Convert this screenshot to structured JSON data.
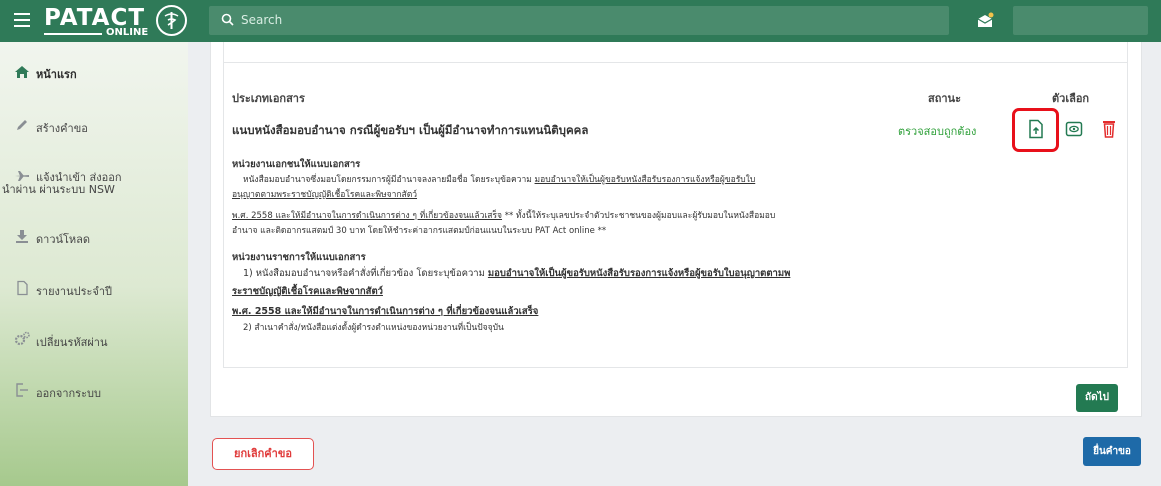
{
  "header": {
    "brand_name": "PATACT",
    "brand_sub": "ONLINE",
    "search_placeholder": "Search"
  },
  "sidebar": {
    "items": [
      {
        "label": "หน้าแรก",
        "icon": "home-icon"
      },
      {
        "label": "สร้างคำขอ",
        "icon": "pencil-icon"
      },
      {
        "label_line1": "แจ้งนำเข้า ส่งออก",
        "label_line2": "นำผ่าน ผ่านระบบ NSW",
        "icon": "plane-icon"
      },
      {
        "label": "ดาวน์โหลด",
        "icon": "download-icon"
      },
      {
        "label": "รายงานประจำปี",
        "icon": "document-icon"
      },
      {
        "label": "เปลี่ยนรหัสผ่าน",
        "icon": "gears-icon"
      },
      {
        "label": "ออกจากระบบ",
        "icon": "logout-icon"
      }
    ]
  },
  "table": {
    "headers": {
      "doc_type": "ประเภทเอกสาร",
      "status": "สถานะ",
      "actions": "ตัวเลือก"
    },
    "row": {
      "title": "แนบหนังสือมอบอำนาจ กรณีผู้ขอรับฯ เป็นผู้มีอำนาจทำการแทนนิติบุคคล",
      "status": "ตรวจสอบถูกต้อง"
    }
  },
  "details": {
    "private": {
      "heading": "หน่วยงานเอกชนให้แนบเอกสาร",
      "l1a": "หนังสือมอบอำนาจซึ่งมอบโดยกรรมการผู้มีอำนาจลงลายมือชื่อ โดยระบุข้อความ ",
      "l1b": "มอบอำนาจให้เป็นผู้ขอรับหนังสือรับรองการแจ้งหรือผู้ขอรับใบ",
      "l2": "อนุญาตตามพระราชบัญญัติเชื้อโรคและพิษจากสัตว์",
      "l3a": "พ.ศ. 2558 และให้มีอำนาจในการดำเนินการต่าง ๆ ที่เกี่ยวข้องจนแล้วเสร็จ",
      "l3b": " ** ทั้งนี้ให้ระบุเลขประจำตัวประชาชนของผู้มอบและผู้รับมอบในหนังสือมอบ",
      "l4": "อำนาจ และติดอากรแสตมป์ 30 บาท โดยให้ชำระค่าอากรแสตมป์ก่อนแนบในระบบ PAT Act online **"
    },
    "government": {
      "heading": "หน่วยงานราชการให้แนบเอกสาร",
      "l1a": "1) หนังสือมอบอำนาจหรือคำสั่งที่เกี่ยวข้อง โดยระบุข้อความ ",
      "l1b": "มอบอำนาจให้เป็นผู้ขอรับหนังสือรับรองการแจ้งหรือผู้ขอรับใบอนุญาตตามพ",
      "l2": "ระราชบัญญัติเชื้อโรคและพิษจากสัตว์",
      "l3": "พ.ศ. 2558 และให้มีอำนาจในการดำเนินการต่าง ๆ ที่เกี่ยวข้องจนแล้วเสร็จ",
      "l4": "2) สำเนาคำสั่ง/หนังสือแต่งตั้งผู้ดำรงตำแหน่งของหน่วยงานที่เป็นปัจจุบัน"
    }
  },
  "buttons": {
    "next": "ถัดไป",
    "cancel": "ยกเลิกคำขอ",
    "submit": "ยื่นคำขอ"
  },
  "colors": {
    "header": "#2f7a58",
    "status_ok": "#2fa03a",
    "highlight": "#e8101a",
    "submit": "#1e6aa8"
  }
}
